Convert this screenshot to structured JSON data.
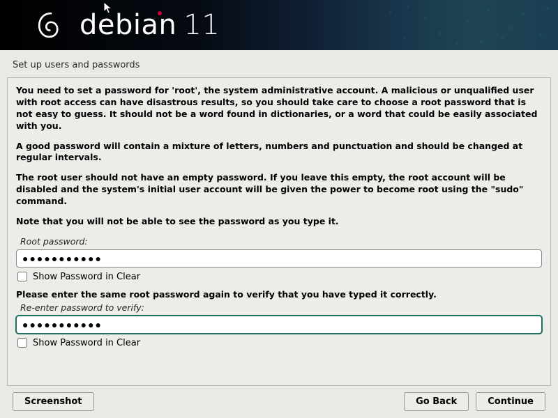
{
  "brand": {
    "name": "debian",
    "version": "11"
  },
  "page_title": "Set up users and passwords",
  "paragraphs": {
    "p1": "You need to set a password for 'root', the system administrative account. A malicious or unqualified user with root access can have disastrous results, so you should take care to choose a root password that is not easy to guess. It should not be a word found in dictionaries, or a word that could be easily associated with you.",
    "p2": "A good password will contain a mixture of letters, numbers and punctuation and should be changed at regular intervals.",
    "p3": "The root user should not have an empty password. If you leave this empty, the root account will be disabled and the system's initial user account will be given the power to become root using the \"sudo\" command.",
    "p4": "Note that you will not be able to see the password as you type it."
  },
  "fields": {
    "root_pw_label": "Root password:",
    "root_pw_value": "●●●●●●●●●●●",
    "show1_label": "Show Password in Clear",
    "show1_checked": false,
    "verify_prompt": "Please enter the same root password again to verify that you have typed it correctly.",
    "verify_label": "Re-enter password to verify:",
    "verify_value": "●●●●●●●●●●●",
    "show2_label": "Show Password in Clear",
    "show2_checked": false
  },
  "buttons": {
    "screenshot": "Screenshot",
    "go_back": "Go Back",
    "continue": "Continue"
  }
}
